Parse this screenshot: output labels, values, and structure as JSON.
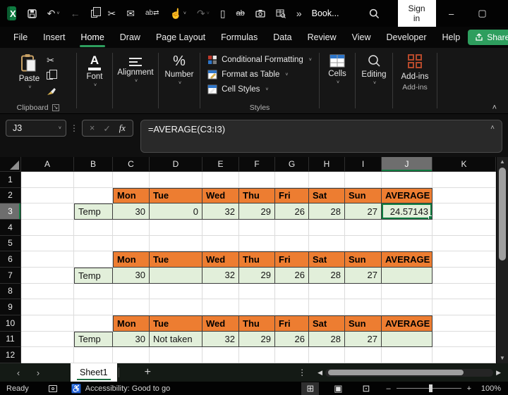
{
  "titlebar": {
    "title": "Book...",
    "signin": "Sign in",
    "qat_icons": [
      "save-icon",
      "undo-icon",
      "back-arrow-icon",
      "copy-icon",
      "cut-icon",
      "draft-email-icon",
      "find-replace-icon",
      "touch-mode-icon",
      "redo-icon",
      "new-file-icon",
      "strikethrough-icon",
      "camera-icon",
      "workbook-stats-icon",
      "more-commands-icon"
    ]
  },
  "menu": {
    "tabs": [
      "File",
      "Insert",
      "Home",
      "Draw",
      "Page Layout",
      "Formulas",
      "Data",
      "Review",
      "View",
      "Developer",
      "Help"
    ],
    "active_tab": "Home",
    "share": "Share"
  },
  "ribbon": {
    "paste_label": "Paste",
    "clipboard_group": "Clipboard",
    "font_group": "Font",
    "alignment_group": "Alignment",
    "number_group": "Number",
    "styles": {
      "items": [
        "Conditional Formatting",
        "Format as Table",
        "Cell Styles"
      ],
      "group": "Styles"
    },
    "cells_group": "Cells",
    "editing_group": "Editing",
    "addins_label": "Add-ins",
    "addins_group": "Add-ins"
  },
  "formula_bar": {
    "cell_reference": "J3",
    "formula": "=AVERAGE(C3:I3)",
    "fx": "fx"
  },
  "grid": {
    "columns": [
      "A",
      "B",
      "C",
      "D",
      "E",
      "F",
      "G",
      "H",
      "I",
      "J",
      "K"
    ],
    "rows": [
      "1",
      "2",
      "3",
      "4",
      "5",
      "6",
      "7",
      "8",
      "9",
      "10",
      "11",
      "12"
    ],
    "selected_column": "J",
    "selected_row": "3",
    "tables": [
      {
        "header_row": "2",
        "data_row": "3",
        "days": [
          "Mon",
          "Tue",
          "Wed",
          "Thu",
          "Fri",
          "Sat",
          "Sun"
        ],
        "average_header": "AVERAGE",
        "row_label": "Temp",
        "values": [
          "30",
          "0",
          "32",
          "29",
          "26",
          "28",
          "27"
        ],
        "average": "24.57143",
        "average_annotated": true
      },
      {
        "header_row": "6",
        "data_row": "7",
        "days": [
          "Mon",
          "Tue",
          "Wed",
          "Thu",
          "Fri",
          "Sat",
          "Sun"
        ],
        "average_header": "AVERAGE",
        "row_label": "Temp",
        "values": [
          "30",
          "",
          "32",
          "29",
          "26",
          "28",
          "27"
        ],
        "average": "",
        "average_annotated": false
      },
      {
        "header_row": "10",
        "data_row": "11",
        "days": [
          "Mon",
          "Tue",
          "Wed",
          "Thu",
          "Fri",
          "Sat",
          "Sun"
        ],
        "average_header": "AVERAGE",
        "row_label": "Temp",
        "values": [
          "30",
          "Not taken",
          "32",
          "29",
          "26",
          "28",
          "27"
        ],
        "average": "",
        "average_annotated": false
      }
    ],
    "colors": {
      "header_fill": "#ED7D31",
      "data_fill": "#E2EFDA",
      "selection_border": "#107C41",
      "annotation_border": "#EB1C24"
    }
  },
  "sheet_bar": {
    "active_tab": "Sheet1"
  },
  "status_bar": {
    "mode": "Ready",
    "accessibility": "Accessibility: Good to go",
    "zoom": "100%"
  }
}
